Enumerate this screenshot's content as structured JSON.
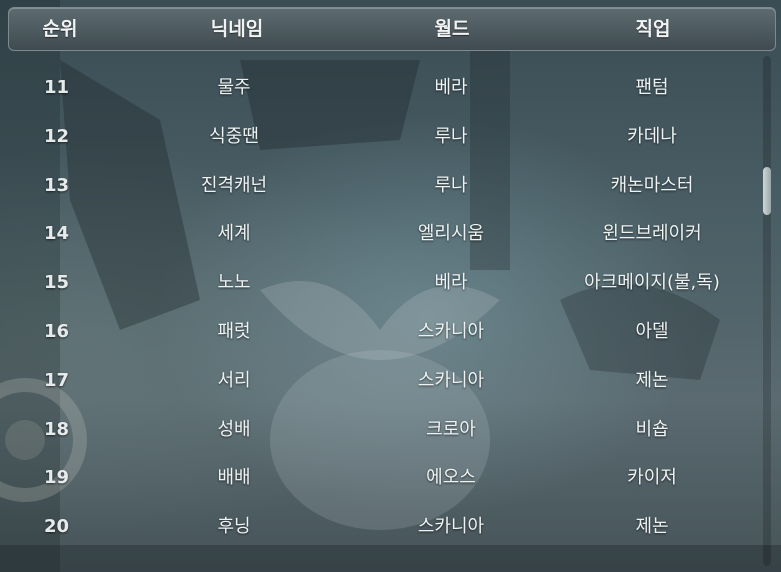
{
  "header": {
    "rank_label": "순위",
    "nickname_label": "닉네임",
    "world_label": "월드",
    "job_label": "직업"
  },
  "rows": [
    {
      "rank": "11",
      "nickname": "물주",
      "world": "베라",
      "job": "팬텀"
    },
    {
      "rank": "12",
      "nickname": "식중땐",
      "world": "루나",
      "job": "카데나"
    },
    {
      "rank": "13",
      "nickname": "진격캐넌",
      "world": "루나",
      "job": "캐논마스터"
    },
    {
      "rank": "14",
      "nickname": "세계",
      "world": "엘리시움",
      "job": "윈드브레이커"
    },
    {
      "rank": "15",
      "nickname": "노노",
      "world": "베라",
      "job": "아크메이지(불,독)"
    },
    {
      "rank": "16",
      "nickname": "패럿",
      "world": "스카니아",
      "job": "아델"
    },
    {
      "rank": "17",
      "nickname": "서리",
      "world": "스카니아",
      "job": "제논"
    },
    {
      "rank": "18",
      "nickname": "성배",
      "world": "크로아",
      "job": "비숍"
    },
    {
      "rank": "19",
      "nickname": "배배",
      "world": "에오스",
      "job": "카이저"
    },
    {
      "rank": "20",
      "nickname": "후닝",
      "world": "스카니아",
      "job": "제논"
    }
  ],
  "scrollbar": {
    "position_fraction": 0.24
  }
}
